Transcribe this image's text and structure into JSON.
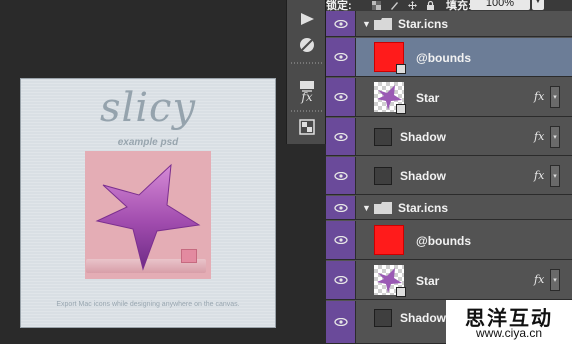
{
  "option_bar": {
    "lock_label": "锁定:",
    "fill_label": "填充:",
    "fill_value": "100%"
  },
  "canvas": {
    "logo_text": "slicy",
    "subtitle": "example psd",
    "caption": "Export Mac icons while designing anywhere on the canvas."
  },
  "tools": {
    "items": [
      "play-icon",
      "brush-circle-icon",
      "fx-icon",
      "adjust-icon"
    ],
    "fx_label": "fx"
  },
  "layers": {
    "rows": [
      {
        "kind": "group",
        "name": "Star.icns"
      },
      {
        "kind": "layer",
        "name": "@bounds",
        "thumb": "red",
        "selected": true
      },
      {
        "kind": "layer",
        "name": "Star",
        "thumb": "star",
        "fx": "fx"
      },
      {
        "kind": "layer",
        "name": "Shadow",
        "thumb": "smart",
        "fx": "fx"
      },
      {
        "kind": "layer",
        "name": "Shadow",
        "thumb": "smart",
        "fx": "fx"
      },
      {
        "kind": "group",
        "name": "Star.icns"
      },
      {
        "kind": "layer",
        "name": "@bounds",
        "thumb": "red"
      },
      {
        "kind": "layer",
        "name": "Star",
        "thumb": "star",
        "fx": "fx"
      },
      {
        "kind": "layer",
        "name": "Shadow",
        "thumb": "smart"
      }
    ]
  },
  "watermark": {
    "chinese": "思洋互动",
    "url": "www.ciya.cn"
  },
  "colors": {
    "eye_column": "#6a4a9a",
    "selected_row": "#6c7d97",
    "bounds_red": "#ff1b1b"
  }
}
